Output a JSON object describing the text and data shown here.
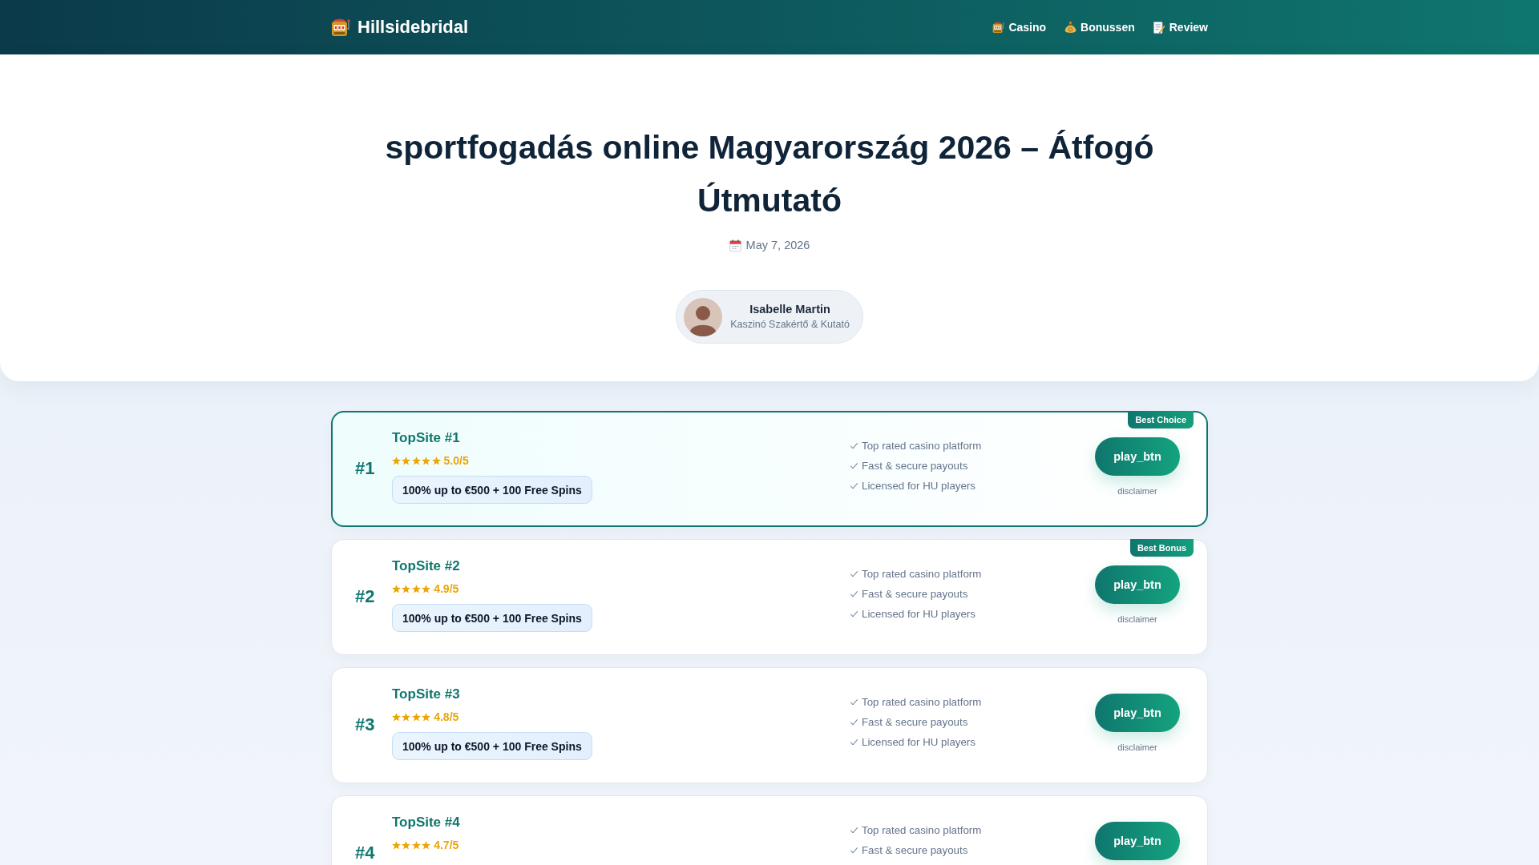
{
  "header": {
    "logo": "Hillsidebridal",
    "nav": [
      {
        "kind": "casino",
        "label": "Casino"
      },
      {
        "kind": "bonus",
        "label": "Bonussen"
      },
      {
        "kind": "review",
        "label": "Review"
      }
    ]
  },
  "hero": {
    "title": "sportfogadás online Magyarország 2026 – Átfogó Útmutató",
    "date": "May 7, 2026",
    "author": {
      "name": "Isabelle Martin",
      "role": "Kaszinó Szakértő & Kutató"
    }
  },
  "sites": [
    {
      "rank": "#1",
      "name": "TopSite #1",
      "featured": true,
      "badge": "Best Choice",
      "stars": 5,
      "rating": "5.0/5",
      "bonus": "100% up to €500 + 100 Free Spins",
      "features": [
        "Top rated casino platform",
        "Fast & secure payouts",
        "Licensed for HU players"
      ],
      "button": "play_btn",
      "disclaimer": "disclaimer"
    },
    {
      "rank": "#2",
      "name": "TopSite #2",
      "featured": false,
      "badge": "Best Bonus",
      "stars": 4,
      "rating": "4.9/5",
      "bonus": "100% up to €500 + 100 Free Spins",
      "features": [
        "Top rated casino platform",
        "Fast & secure payouts",
        "Licensed for HU players"
      ],
      "button": "play_btn",
      "disclaimer": "disclaimer"
    },
    {
      "rank": "#3",
      "name": "TopSite #3",
      "featured": false,
      "stars": 4,
      "rating": "4.8/5",
      "bonus": "100% up to €500 + 100 Free Spins",
      "features": [
        "Top rated casino platform",
        "Fast & secure payouts",
        "Licensed for HU players"
      ],
      "button": "play_btn",
      "disclaimer": "disclaimer"
    },
    {
      "rank": "#4",
      "name": "TopSite #4",
      "featured": false,
      "stars": 4,
      "rating": "4.7/5",
      "features": [
        "Top rated casino platform",
        "Fast & secure payouts"
      ],
      "button": "play_btn"
    }
  ]
}
